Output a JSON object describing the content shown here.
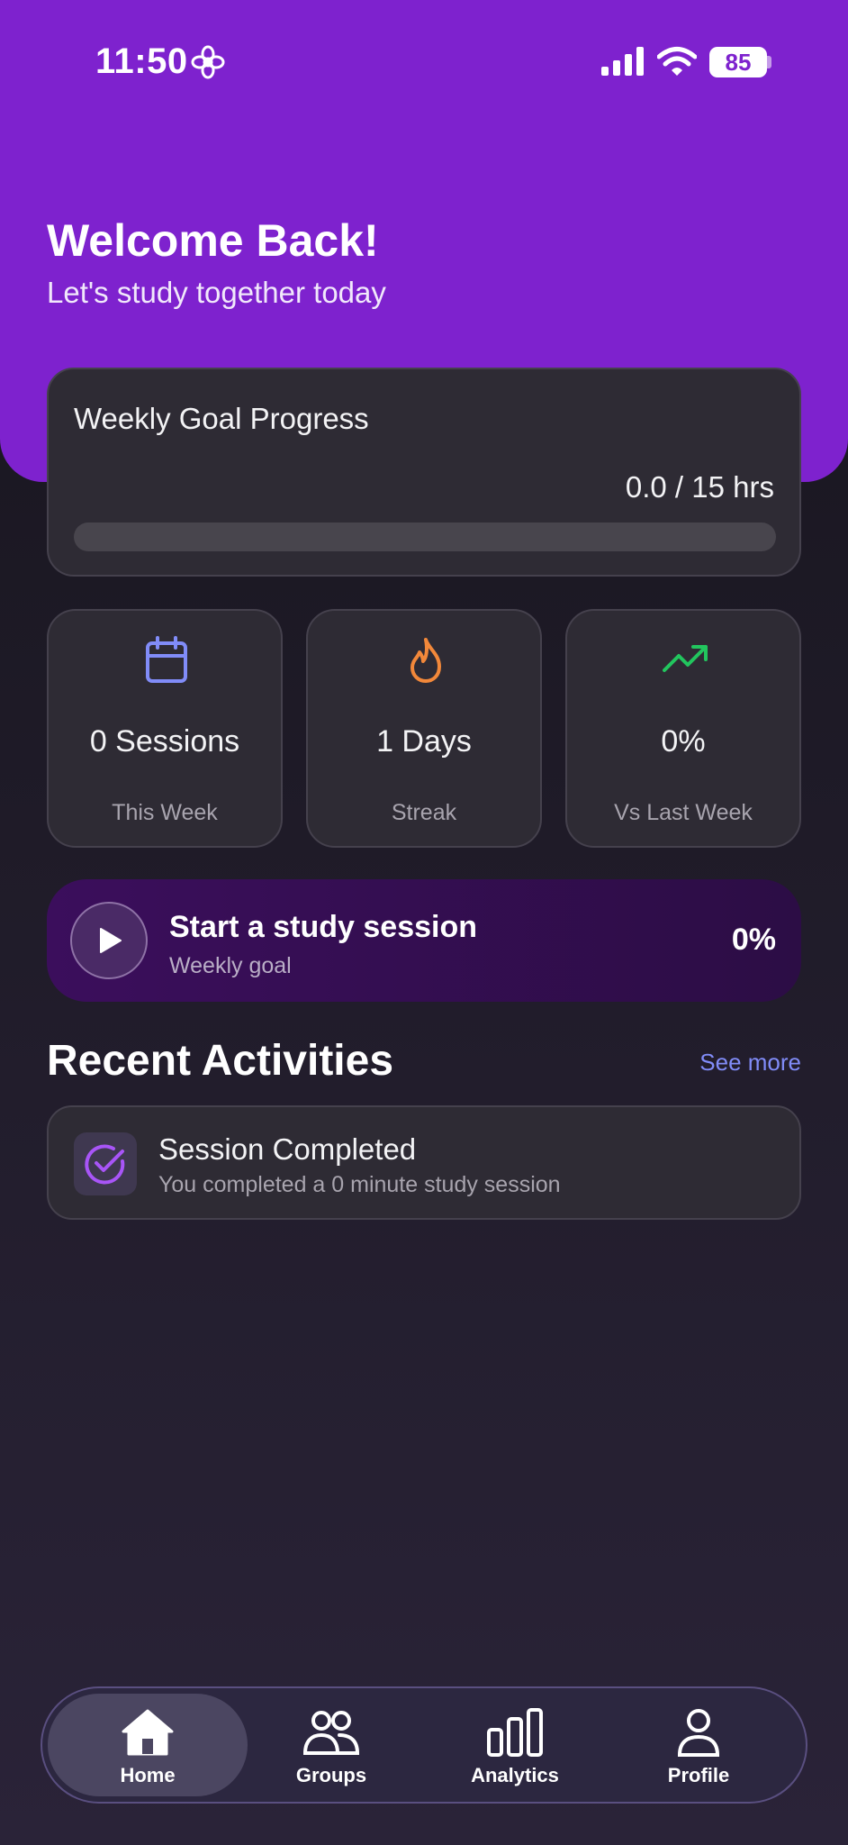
{
  "status_bar": {
    "time": "11:50",
    "battery": "85"
  },
  "header": {
    "title": "Welcome Back!",
    "subtitle": "Let's study together today"
  },
  "weekly_goal": {
    "title": "Weekly Goal Progress",
    "value_text": "0.0 / 15 hrs",
    "progress_fraction": 0
  },
  "stats": [
    {
      "icon": "calendar-icon",
      "value": "0 Sessions",
      "label": "This Week",
      "color": "#818cf8"
    },
    {
      "icon": "flame-icon",
      "value": "1 Days",
      "label": "Streak",
      "color": "#f2883a"
    },
    {
      "icon": "trending-up-icon",
      "value": "0%",
      "label": "Vs Last Week",
      "color": "#22c55e"
    }
  ],
  "session_banner": {
    "title": "Start a study session",
    "subtitle": "Weekly goal",
    "percent": "0%"
  },
  "recent": {
    "title": "Recent Activities",
    "see_more": "See more",
    "items": [
      {
        "icon": "check-circle-icon",
        "title": "Session Completed",
        "subtitle": "You completed a 0 minute study session"
      }
    ]
  },
  "nav": {
    "active": "Home",
    "items": [
      {
        "label": "Home",
        "icon": "home-icon"
      },
      {
        "label": "Groups",
        "icon": "groups-icon"
      },
      {
        "label": "Analytics",
        "icon": "analytics-icon"
      },
      {
        "label": "Profile",
        "icon": "profile-icon"
      }
    ]
  },
  "colors": {
    "header_bg": "#7e22ce",
    "card_bg": "#2e2b34",
    "accent_link": "#818cf8",
    "activity_icon": "#a855f7"
  }
}
